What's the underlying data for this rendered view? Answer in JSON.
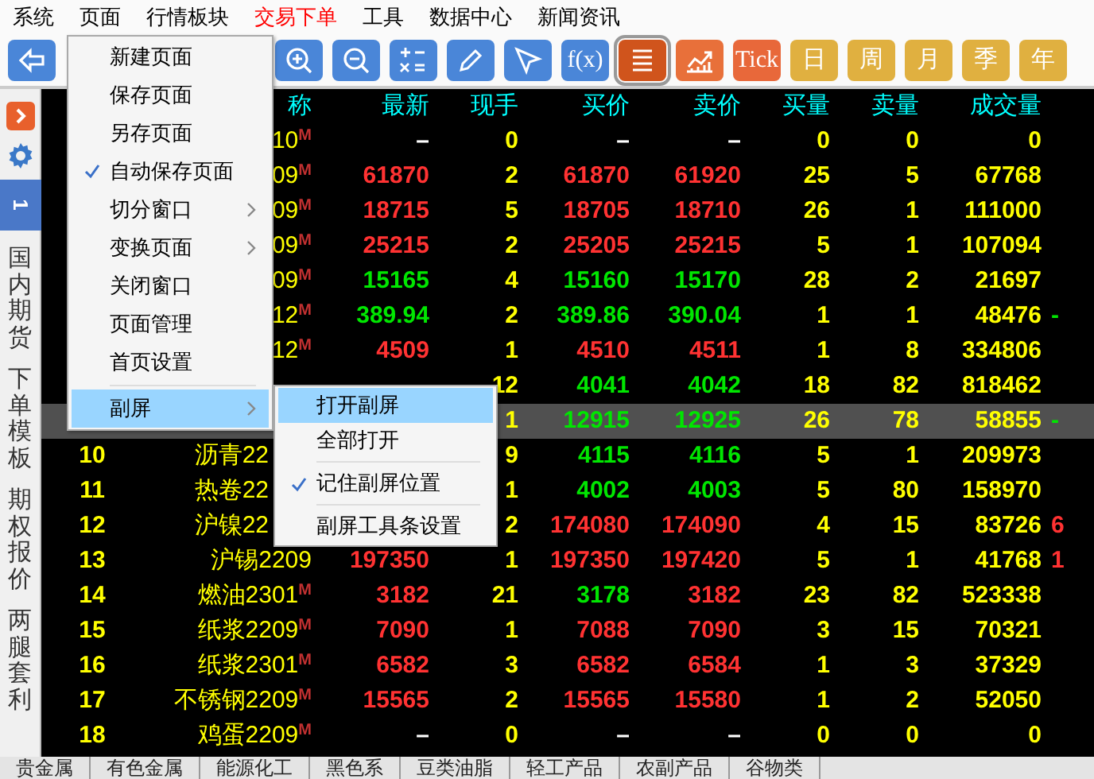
{
  "menubar": [
    {
      "label": "系统",
      "color": "#000000"
    },
    {
      "label": "页面",
      "color": "#000000"
    },
    {
      "label": "行情板块",
      "color": "#000000"
    },
    {
      "label": "交易下单",
      "color": "#ff0000"
    },
    {
      "label": "工具",
      "color": "#000000"
    },
    {
      "label": "数据中心",
      "color": "#000000"
    },
    {
      "label": "新闻资讯",
      "color": "#000000"
    }
  ],
  "toolbar": [
    {
      "kind": "icon",
      "color": "#4a86d8",
      "selected": false
    },
    {
      "kind": "icon",
      "color": "#4a86d8",
      "selected": false
    },
    {
      "kind": "icon",
      "color": "#4a86d8",
      "selected": false
    },
    {
      "kind": "icon",
      "color": "#4a86d8",
      "selected": false
    },
    {
      "kind": "icon",
      "color": "#4a86d8",
      "selected": false
    },
    {
      "kind": "icon",
      "color": "#4a86d8",
      "selected": false
    },
    {
      "kind": "text",
      "label": "f(x)",
      "color": "#4a86d8",
      "selected": false
    },
    {
      "kind": "icon",
      "color": "#d0541c",
      "selected": true
    },
    {
      "kind": "icon",
      "color": "#e8703a",
      "selected": false
    },
    {
      "kind": "text",
      "label": "Tick",
      "color": "#e8683a",
      "selected": false
    },
    {
      "kind": "text",
      "label": "日",
      "color": "#e0b040",
      "selected": false
    },
    {
      "kind": "text",
      "label": "周",
      "color": "#e0b040",
      "selected": false
    },
    {
      "kind": "text",
      "label": "月",
      "color": "#e0b040",
      "selected": false
    },
    {
      "kind": "text",
      "label": "季",
      "color": "#e0b040",
      "selected": false
    },
    {
      "kind": "text",
      "label": "年",
      "color": "#e0b040",
      "selected": false
    }
  ],
  "sidebar": {
    "page_tab": {
      "label": "1",
      "selected": true
    },
    "tabs": [
      {
        "label": "国内期货",
        "selected": false
      },
      {
        "label": "下单模板",
        "selected": false
      },
      {
        "label": "期权报价",
        "selected": false
      },
      {
        "label": "两腿套利",
        "selected": false
      }
    ]
  },
  "table": {
    "columns": [
      "",
      "称",
      "最新",
      "现手",
      "买价",
      "卖价",
      "买量",
      "卖量",
      "成交量",
      ""
    ],
    "rows": [
      {
        "selected": false,
        "name": "10$^{M}$",
        "last": {
          "text": "–",
          "color": "#ffffff"
        },
        "lots": "0",
        "bid": {
          "text": "–",
          "color": "#ffffff"
        },
        "ask": {
          "text": "–",
          "color": "#ffffff"
        },
        "bid_qty": "0",
        "ask_qty": "0",
        "volume": "0"
      },
      {
        "selected": false,
        "name": "09$^{M}$",
        "last": {
          "text": "61870",
          "color": "#ff3232"
        },
        "lots": "2",
        "bid": {
          "text": "61870",
          "color": "#ff3232"
        },
        "ask": {
          "text": "61920",
          "color": "#ff3232"
        },
        "bid_qty": "25",
        "ask_qty": "5",
        "volume": "67768"
      },
      {
        "selected": false,
        "name": "09$^{M}$",
        "last": {
          "text": "18715",
          "color": "#ff3232"
        },
        "lots": "5",
        "bid": {
          "text": "18705",
          "color": "#ff3232"
        },
        "ask": {
          "text": "18710",
          "color": "#ff3232"
        },
        "bid_qty": "26",
        "ask_qty": "1",
        "volume": "111000"
      },
      {
        "selected": false,
        "name": "09$^{M}$",
        "last": {
          "text": "25215",
          "color": "#ff3232"
        },
        "lots": "2",
        "bid": {
          "text": "25205",
          "color": "#ff3232"
        },
        "ask": {
          "text": "25215",
          "color": "#ff3232"
        },
        "bid_qty": "5",
        "ask_qty": "1",
        "volume": "107094"
      },
      {
        "selected": false,
        "name": "09$^{M}$",
        "last": {
          "text": "15165",
          "color": "#00e600"
        },
        "lots": "4",
        "bid": {
          "text": "15160",
          "color": "#00e600"
        },
        "ask": {
          "text": "15170",
          "color": "#00e600"
        },
        "bid_qty": "28",
        "ask_qty": "2",
        "volume": "21697"
      },
      {
        "selected": false,
        "name": "12$^{M}$",
        "last": {
          "text": "389.94",
          "color": "#00e600"
        },
        "lots": "2",
        "bid": {
          "text": "389.86",
          "color": "#00e600"
        },
        "ask": {
          "text": "390.04",
          "color": "#00e600"
        },
        "bid_qty": "1",
        "ask_qty": "1",
        "volume": "48476",
        "change": {
          "text": "-",
          "color": "#00e600"
        }
      },
      {
        "selected": false,
        "name": "12$^{M}$",
        "last": {
          "text": "4509",
          "color": "#ff3232"
        },
        "lots": "1",
        "bid": {
          "text": "4510",
          "color": "#ff3232"
        },
        "ask": {
          "text": "4511",
          "color": "#ff3232"
        },
        "bid_qty": "1",
        "ask_qty": "8",
        "volume": "334806"
      },
      {
        "selected": false,
        "lots": "12",
        "bid": {
          "text": "4041",
          "color": "#00e600"
        },
        "ask": {
          "text": "4042",
          "color": "#00e600"
        },
        "bid_qty": "18",
        "ask_qty": "82",
        "volume": "818462"
      },
      {
        "selected": true,
        "lots": "1",
        "bid": {
          "text": "12915",
          "color": "#00e600"
        },
        "ask": {
          "text": "12925",
          "color": "#00e600"
        },
        "bid_qty": "26",
        "ask_qty": "78",
        "volume": "58855",
        "change": {
          "text": "-",
          "color": "#00e600"
        }
      },
      {
        "selected": false,
        "no": "10",
        "name": "沥青22",
        "lots": "9",
        "bid": {
          "text": "4115",
          "color": "#00e600"
        },
        "ask": {
          "text": "4116",
          "color": "#00e600"
        },
        "bid_qty": "5",
        "ask_qty": "1",
        "volume": "209973"
      },
      {
        "selected": false,
        "no": "11",
        "name": "热卷22",
        "lots": "1",
        "bid": {
          "text": "4002",
          "color": "#00e600"
        },
        "ask": {
          "text": "4003",
          "color": "#00e600"
        },
        "bid_qty": "5",
        "ask_qty": "80",
        "volume": "158970"
      },
      {
        "selected": false,
        "no": "12",
        "name": "沪镍22",
        "lots": "2",
        "bid": {
          "text": "174080",
          "color": "#ff3232"
        },
        "ask": {
          "text": "174090",
          "color": "#ff3232"
        },
        "bid_qty": "4",
        "ask_qty": "15",
        "volume": "83726",
        "change": {
          "text": "6",
          "color": "#ff3232"
        }
      },
      {
        "selected": false,
        "no": "13",
        "name": "沪锡2209",
        "last": {
          "text": "197350",
          "color": "#ff3232"
        },
        "lots": "1",
        "bid": {
          "text": "197350",
          "color": "#ff3232"
        },
        "ask": {
          "text": "197420",
          "color": "#ff3232"
        },
        "bid_qty": "5",
        "ask_qty": "1",
        "volume": "41768",
        "change": {
          "text": "1",
          "color": "#ff3232"
        }
      },
      {
        "selected": false,
        "no": "14",
        "name": "燃油2301$^{M}$",
        "last": {
          "text": "3182",
          "color": "#ff3232"
        },
        "lots": "21",
        "bid": {
          "text": "3178",
          "color": "#00e600"
        },
        "ask": {
          "text": "3182",
          "color": "#ff3232"
        },
        "bid_qty": "23",
        "ask_qty": "82",
        "volume": "523338"
      },
      {
        "selected": false,
        "no": "15",
        "name": "纸浆2209$^{M}$",
        "last": {
          "text": "7090",
          "color": "#ff3232"
        },
        "lots": "1",
        "bid": {
          "text": "7088",
          "color": "#ff3232"
        },
        "ask": {
          "text": "7090",
          "color": "#ff3232"
        },
        "bid_qty": "3",
        "ask_qty": "15",
        "volume": "70321"
      },
      {
        "selected": false,
        "no": "16",
        "name": "纸浆2301$^{M}$",
        "last": {
          "text": "6582",
          "color": "#ff3232"
        },
        "lots": "3",
        "bid": {
          "text": "6582",
          "color": "#ff3232"
        },
        "ask": {
          "text": "6584",
          "color": "#ff3232"
        },
        "bid_qty": "1",
        "ask_qty": "3",
        "volume": "37329"
      },
      {
        "selected": false,
        "no": "17",
        "name": "不锈钢2209$^{M}$",
        "last": {
          "text": "15565",
          "color": "#ff3232"
        },
        "lots": "2",
        "bid": {
          "text": "15565",
          "color": "#ff3232"
        },
        "ask": {
          "text": "15580",
          "color": "#ff3232"
        },
        "bid_qty": "1",
        "ask_qty": "2",
        "volume": "52050"
      },
      {
        "selected": false,
        "no": "18",
        "name": "鸡蛋2209$^{M}$",
        "last": {
          "text": "–",
          "color": "#ffffff"
        },
        "lots": "0",
        "bid": {
          "text": "–",
          "color": "#ffffff"
        },
        "ask": {
          "text": "–",
          "color": "#ffffff"
        },
        "bid_qty": "0",
        "ask_qty": "0",
        "volume": "0"
      }
    ]
  },
  "bottom_tabs": [
    {
      "label": "贵金属",
      "selected": false
    },
    {
      "label": "有色金属",
      "selected": false
    },
    {
      "label": "能源化工",
      "selected": false
    },
    {
      "label": "黑色系",
      "selected": false
    },
    {
      "label": "豆类油脂",
      "selected": false
    },
    {
      "label": "轻工产品",
      "selected": false
    },
    {
      "label": "农副产品",
      "selected": false
    },
    {
      "label": "谷物类",
      "selected": false
    }
  ],
  "page_menu": {
    "items": [
      {
        "kind": "item",
        "label": "新建页面",
        "checked": false,
        "submenu": false,
        "selected": false
      },
      {
        "kind": "item",
        "label": "保存页面",
        "checked": false,
        "submenu": false,
        "selected": false
      },
      {
        "kind": "item",
        "label": "另存页面",
        "checked": false,
        "submenu": false,
        "selected": false
      },
      {
        "kind": "item",
        "label": "自动保存页面",
        "checked": true,
        "submenu": false,
        "selected": false
      },
      {
        "kind": "item",
        "label": "切分窗口",
        "checked": false,
        "submenu": true,
        "selected": false
      },
      {
        "kind": "item",
        "label": "变换页面",
        "checked": false,
        "submenu": true,
        "selected": false
      },
      {
        "kind": "item",
        "label": "关闭窗口",
        "checked": false,
        "submenu": false,
        "selected": false
      },
      {
        "kind": "item",
        "label": "页面管理",
        "checked": false,
        "submenu": false,
        "selected": false
      },
      {
        "kind": "item",
        "label": "首页设置",
        "checked": false,
        "submenu": false,
        "selected": false
      },
      {
        "kind": "separator"
      },
      {
        "kind": "item",
        "label": "副屏",
        "checked": false,
        "submenu": true,
        "selected": true
      }
    ]
  },
  "sub_menu": {
    "items": [
      {
        "kind": "item",
        "label": "打开副屏",
        "checked": false,
        "submenu": false,
        "selected": true
      },
      {
        "kind": "item",
        "label": "全部打开",
        "checked": false,
        "submenu": false,
        "selected": false
      },
      {
        "kind": "separator"
      },
      {
        "kind": "item",
        "label": "记住副屏位置",
        "checked": true,
        "submenu": false,
        "selected": false
      },
      {
        "kind": "separator"
      },
      {
        "kind": "item",
        "label": "副屏工具条设置",
        "checked": false,
        "submenu": false,
        "selected": false
      }
    ]
  }
}
